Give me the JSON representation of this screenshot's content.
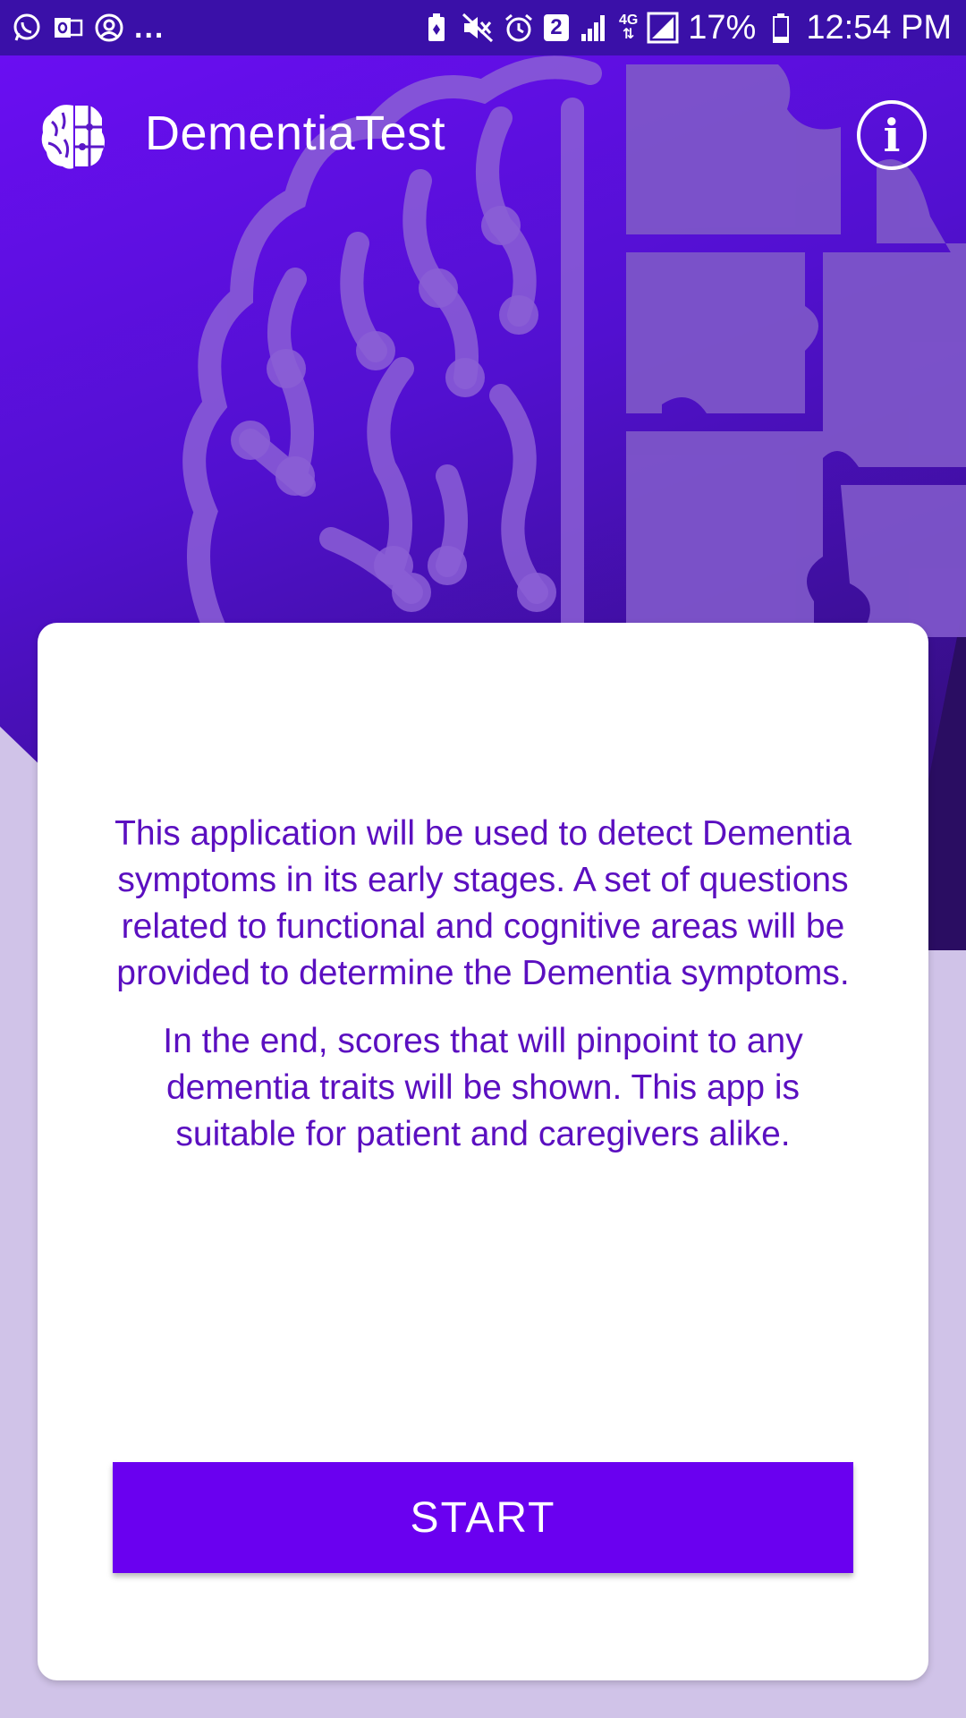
{
  "status_bar": {
    "left_icons": [
      "whatsapp-icon",
      "outlook-icon",
      "account-circle-icon"
    ],
    "more_label": "...",
    "right_icons": [
      "battery-saver-icon",
      "mute-icon",
      "alarm-icon",
      "sim-2-icon",
      "signal-icon",
      "4g-icon",
      "data-icon",
      "battery-icon"
    ],
    "sim_label": "2",
    "network_label": "4G",
    "battery_label": "17%",
    "time": "12:54 PM",
    "color": "#3a10a8"
  },
  "header": {
    "logo_icon": "brain-puzzle-logo-icon",
    "title": "DementiaTest",
    "info_icon": "info-icon",
    "info_label": "i"
  },
  "card": {
    "paragraphs": [
      "This application will be used to detect Dementia symptoms in its early stages. A set of questions related to functional and cognitive areas will be provided to determine the Dementia symptoms.",
      "In the end, scores that will pinpoint to any dementia traits will be shown. This app is suitable for patient and caregivers alike."
    ],
    "start_label": "START"
  },
  "colors": {
    "accent": "#6a00f0",
    "text": "#5b0fc0",
    "background": "#d0c3e8",
    "hero_dark": "#2a0d62"
  }
}
